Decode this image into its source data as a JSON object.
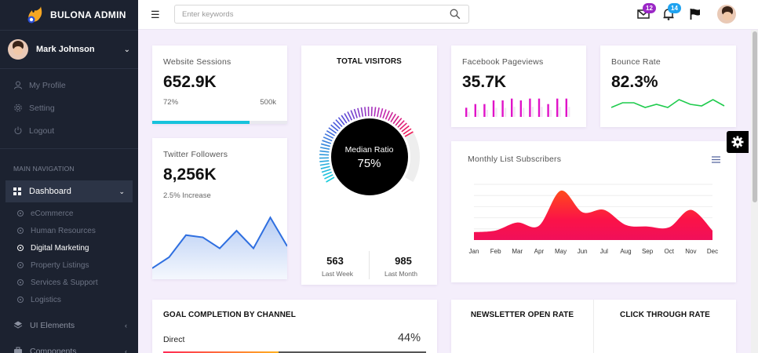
{
  "brand": {
    "name": "BULONA ADMIN"
  },
  "user": {
    "name": "Mark Johnson"
  },
  "user_menu": [
    {
      "label": "My Profile",
      "icon": "user-icon"
    },
    {
      "label": "Setting",
      "icon": "gear-icon"
    },
    {
      "label": "Logout",
      "icon": "power-icon"
    }
  ],
  "nav": {
    "heading": "MAIN NAVIGATION",
    "dashboard": "Dashboard",
    "sub_items": [
      "eCommerce",
      "Human Resources",
      "Digital Marketing",
      "Property Listings",
      "Services & Support",
      "Logistics"
    ],
    "active_sub": "Digital Marketing",
    "groups": [
      "UI Elements",
      "Components"
    ]
  },
  "search": {
    "placeholder": "Enter keywords"
  },
  "notifications": {
    "mail_count": "12",
    "bell_count": "14"
  },
  "colors": {
    "sidebar": "#1c2230",
    "accent_cyan": "#17c2dc",
    "mail_badge": "#9b27c6",
    "bell_badge": "#1fa3f0",
    "pageviews": "#e013c8",
    "bounce": "#1fcb4d"
  },
  "sessions": {
    "label": "Website Sessions",
    "value": "652.9K",
    "percent": "72%",
    "target": "500k",
    "progress": 0.72
  },
  "twitter": {
    "label": "Twitter Followers",
    "value": "8,256K",
    "note": "2.5% Increase"
  },
  "visitors": {
    "title": "TOTAL VISITORS",
    "gauge_label": "Median Ratio",
    "gauge_value": "75%",
    "ratio": 0.75,
    "week_value": "563",
    "week_label": "Last Week",
    "month_value": "985",
    "month_label": "Last Month"
  },
  "facebook": {
    "label": "Facebook Pageviews",
    "value": "35.7K"
  },
  "bounce": {
    "label": "Bounce Rate",
    "value": "82.3%"
  },
  "subscribers": {
    "label": "Monthly List Subscribers"
  },
  "goal": {
    "title": "GOAL COMPLETION BY CHANNEL",
    "row_label": "Direct",
    "row_value": "44%"
  },
  "newsletter": {
    "title": "NEWSLETTER OPEN RATE"
  },
  "click": {
    "title": "CLICK THROUGH RATE"
  },
  "chart_data": [
    {
      "type": "line",
      "series": [
        {
          "values": [
            5,
            10,
            20,
            19,
            14,
            22,
            14,
            28,
            15
          ]
        }
      ]
    },
    {
      "type": "bar",
      "series": [
        {
          "values": [
            5,
            7,
            7,
            9,
            9,
            10,
            9,
            10,
            10,
            7,
            10,
            10
          ]
        }
      ]
    },
    {
      "type": "line",
      "series": [
        {
          "values": [
            6,
            9,
            9,
            6,
            8,
            6,
            11,
            8,
            7,
            11,
            7
          ]
        }
      ]
    },
    {
      "type": "area",
      "categories": [
        "Jan",
        "Feb",
        "Mar",
        "Apr",
        "May",
        "Jun",
        "Jul",
        "Aug",
        "Sep",
        "Oct",
        "Nov",
        "Dec"
      ],
      "series": [
        {
          "values": [
            10,
            12,
            22,
            18,
            62,
            35,
            38,
            19,
            17,
            16,
            38,
            12
          ]
        }
      ]
    }
  ]
}
